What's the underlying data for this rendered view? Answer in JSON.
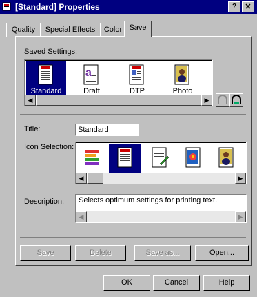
{
  "window": {
    "title": "[Standard] Properties",
    "help_glyph": "?",
    "close_glyph": "✕"
  },
  "tabs": [
    {
      "label": "Quality",
      "active": false
    },
    {
      "label": "Special Effects",
      "active": false
    },
    {
      "label": "Color",
      "active": false
    },
    {
      "label": "Save",
      "active": true
    }
  ],
  "saved_settings": {
    "label": "Saved Settings:",
    "items": [
      {
        "label": "Standard",
        "icon": "standard-doc-icon",
        "selected": true
      },
      {
        "label": "Draft",
        "icon": "draft-doc-icon",
        "selected": false
      },
      {
        "label": "DTP",
        "icon": "dtp-doc-icon",
        "selected": false
      },
      {
        "label": "Photo",
        "icon": "photo-doc-icon",
        "selected": false
      }
    ]
  },
  "title_field": {
    "label": "Title:",
    "value": "Standard"
  },
  "icon_selection": {
    "label": "Icon Selection:",
    "icons": [
      "rainbow-e-icon",
      "standard-doc-icon",
      "pen-doc-icon",
      "flower-doc-icon",
      "portrait-doc-icon"
    ],
    "selected_index": 1
  },
  "description": {
    "label": "Description:",
    "value": "Selects optimum settings for printing text."
  },
  "action_buttons": {
    "save": "Save",
    "delete": "Delete",
    "save_as": "Save as...",
    "open": "Open..."
  },
  "dialog_buttons": {
    "ok": "OK",
    "cancel": "Cancel",
    "help": "Help"
  },
  "colors": {
    "titlebar": "#000080",
    "selection": "#000080",
    "face": "#c0c0c0"
  }
}
